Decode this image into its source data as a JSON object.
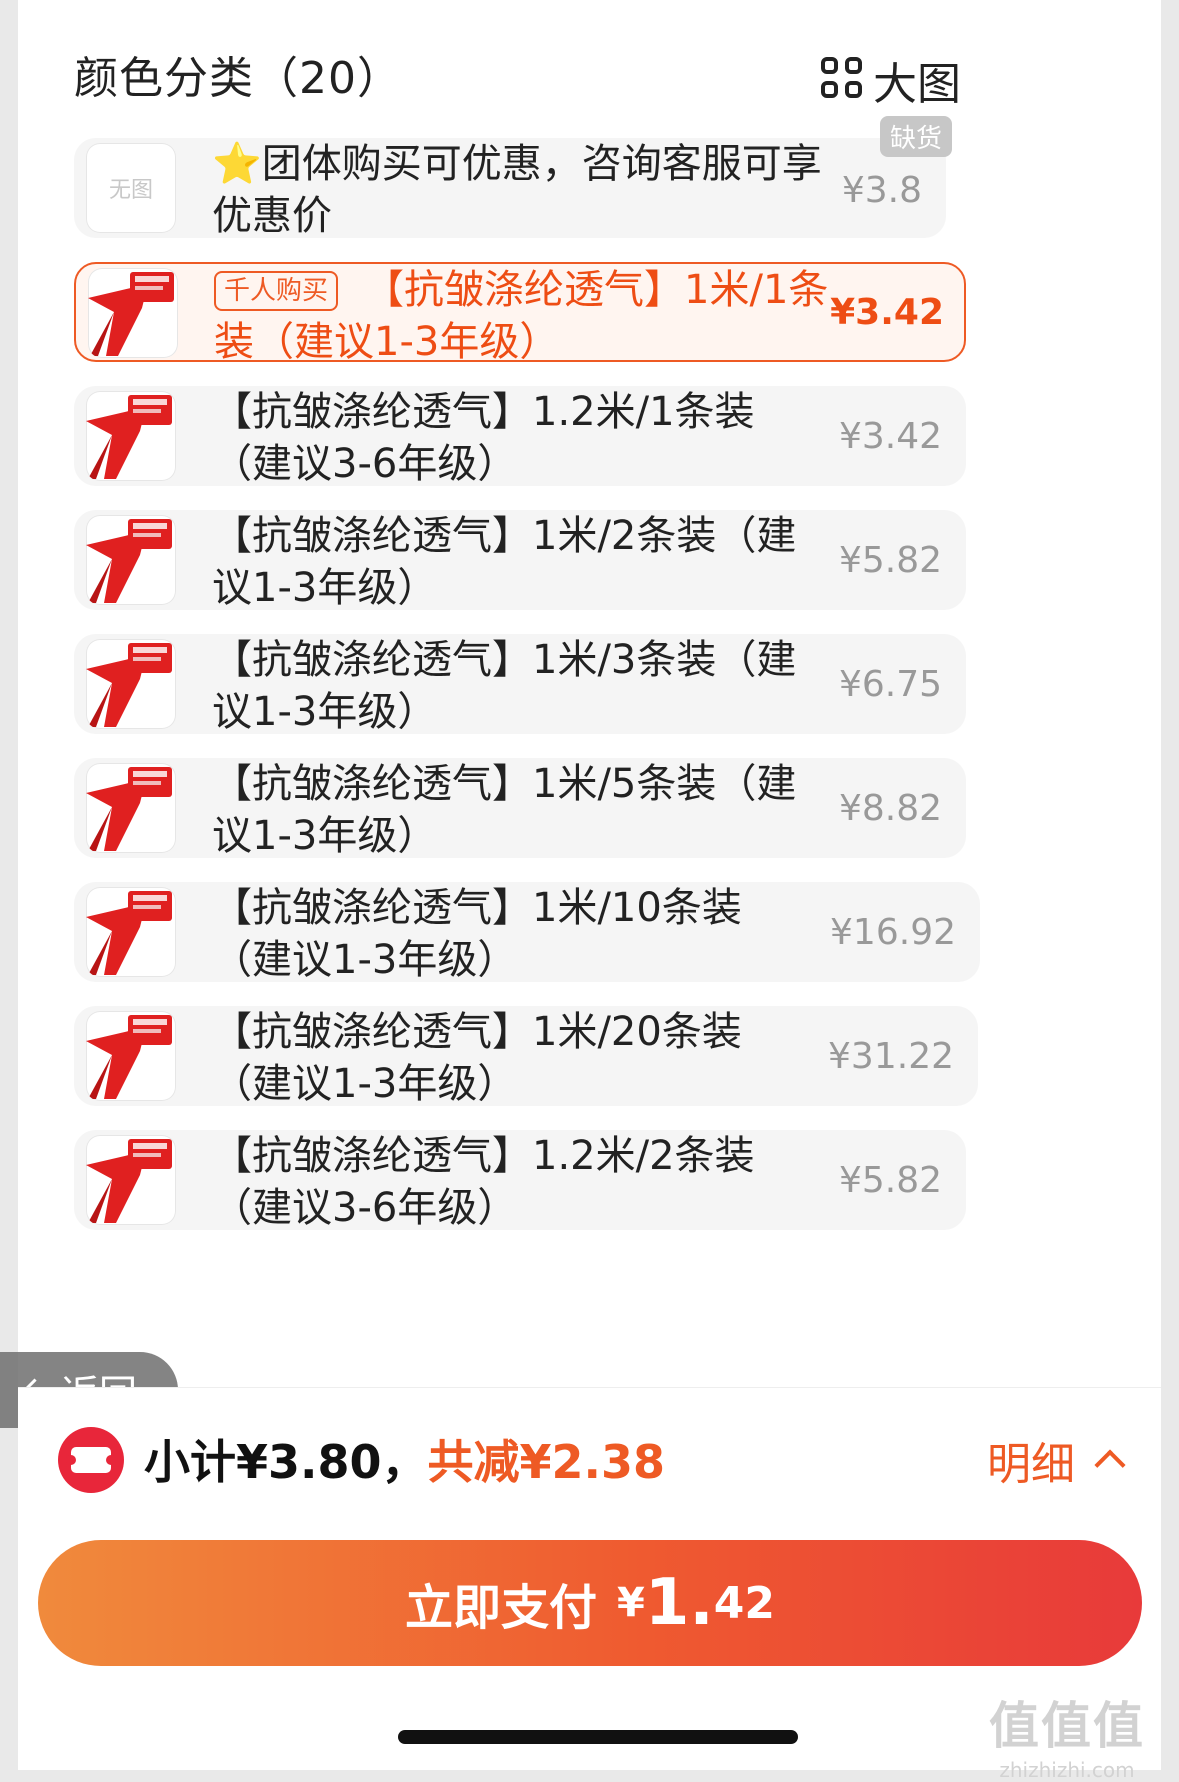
{
  "header": {
    "title": "颜色分类（20）",
    "view_label": "大图"
  },
  "items": [
    {
      "label": "⭐团体购买可优惠，咨询客服可享优惠价",
      "price": "¥3.8",
      "thumb": "无图",
      "badge": "缺货",
      "selected": false
    },
    {
      "hot_badge": "千人购买",
      "label": "【抗皱涤纶透气】1米/1条装（建议1-3年级）",
      "price": "¥3.42",
      "selected": true
    },
    {
      "label": "【抗皱涤纶透气】1.2米/1条装（建议3-6年级）",
      "price": "¥3.42",
      "selected": false
    },
    {
      "label": "【抗皱涤纶透气】1米/2条装（建议1-3年级）",
      "price": "¥5.82",
      "selected": false
    },
    {
      "label": "【抗皱涤纶透气】1米/3条装（建议1-3年级）",
      "price": "¥6.75",
      "selected": false
    },
    {
      "label": "【抗皱涤纶透气】1米/5条装（建议1-3年级）",
      "price": "¥8.82",
      "selected": false
    },
    {
      "label": "【抗皱涤纶透气】1米/10条装（建议1-3年级）",
      "price": "¥16.92",
      "selected": false
    },
    {
      "label": "【抗皱涤纶透气】1米/20条装（建议1-3年级）",
      "price": "¥31.22",
      "selected": false
    },
    {
      "label": "【抗皱涤纶透气】1.2米/2条装（建议3-6年级）",
      "price": "¥5.82",
      "selected": false
    }
  ],
  "back": {
    "label": "返回"
  },
  "footer": {
    "subtotal": "小计¥3.80，",
    "discount": "共减¥2.38",
    "detail_label": "明细",
    "pay_text": "立即支付",
    "pay_yen": "¥",
    "pay_int": "1.",
    "pay_dec": "42"
  },
  "watermark": {
    "line1": "值值值",
    "line2": "zhizhizhi.com"
  },
  "colors": {
    "accent": "#ee5a24",
    "badge_bg": "#e8263a"
  }
}
